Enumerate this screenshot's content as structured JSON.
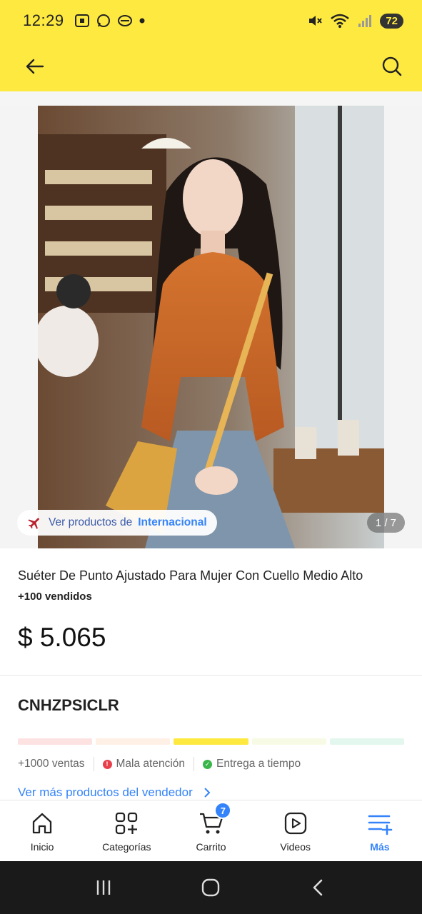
{
  "status_bar": {
    "time": "12:29",
    "battery": "72",
    "icons": [
      "screenshot-icon",
      "whatsapp-icon",
      "app-icon",
      "dot-icon",
      "mute-icon",
      "wifi-icon",
      "signal-icon"
    ]
  },
  "app_bar": {
    "back_icon": "arrow-left-icon",
    "search_icon": "search-icon"
  },
  "gallery": {
    "international_pill": {
      "prefix": "Ver productos de",
      "highlight": "Internacional"
    },
    "counter": "1 / 7"
  },
  "product": {
    "title": "Suéter De Punto Ajustado Para Mujer Con Cuello Medio Alto",
    "sold": "+100 vendidos",
    "price": "$ 5.065"
  },
  "seller": {
    "name": "CNHZPSICLR",
    "reputation_colors": [
      "#fde2e2",
      "#fff0e6",
      "#fff159",
      "#f7fbe5",
      "#e3f7ee"
    ],
    "sales": "+1000 ventas",
    "attention": "Mala atención",
    "delivery": "Entrega a tiempo",
    "more_link": "Ver más productos del vendedor"
  },
  "bottom_nav": {
    "items": [
      {
        "label": "Inicio",
        "icon": "home-icon"
      },
      {
        "label": "Categorías",
        "icon": "categories-icon"
      },
      {
        "label": "Carrito",
        "icon": "cart-icon",
        "badge": "7"
      },
      {
        "label": "Videos",
        "icon": "video-icon"
      },
      {
        "label": "Más",
        "icon": "menu-plus-icon",
        "active": true
      }
    ]
  },
  "colors": {
    "brand_yellow": "#fde940",
    "accent_blue": "#3483fa",
    "error_red": "#e8404a",
    "success_green": "#39b54a"
  }
}
